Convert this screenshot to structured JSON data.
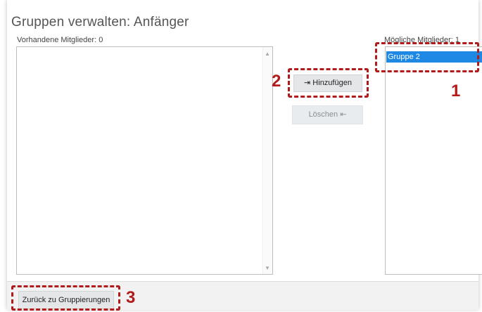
{
  "page": {
    "title": "Gruppen verwalten: Anfänger"
  },
  "left_panel": {
    "label": "Vorhandene Mitglieder: 0",
    "items": []
  },
  "right_panel": {
    "label": "Mögliche Mitglieder: 1",
    "items": [
      {
        "label": "Gruppe 2",
        "selected": true
      }
    ]
  },
  "actions": {
    "add_label": "⇥ Hinzufügen",
    "remove_label": "Löschen ⇤",
    "remove_enabled": false
  },
  "footer": {
    "back_label": "Zurück zu Gruppierungen"
  },
  "annotations": {
    "marker_1": "1",
    "marker_2": "2",
    "marker_3": "3",
    "color": "#b11b1b"
  },
  "colors": {
    "selection": "#1e88e5",
    "button_bg": "#e4e6e8",
    "footer_bg": "#f2f2f2"
  }
}
